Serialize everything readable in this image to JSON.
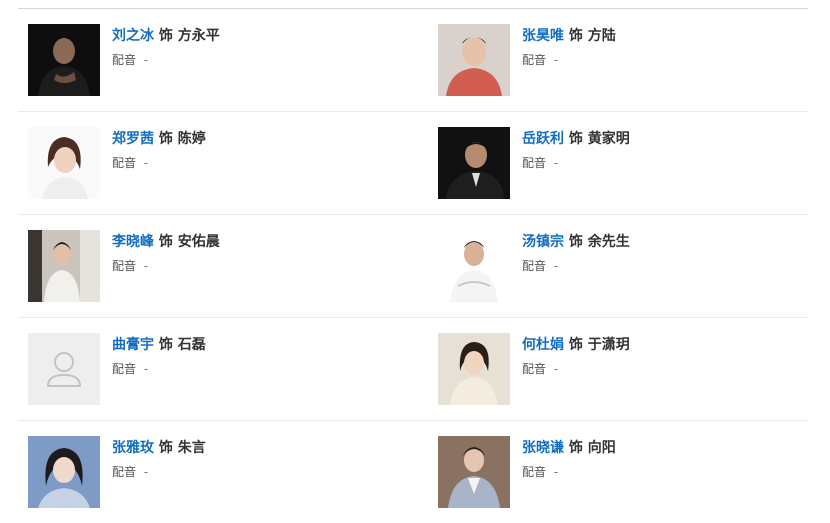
{
  "cast_list": {
    "as_word": "饰",
    "voice_label": "配音",
    "voice_empty": "-",
    "rows": [
      [
        {
          "actor": "刘之冰",
          "role": "方永平",
          "avatar": "portrait-dark-suit"
        },
        {
          "actor": "张昊唯",
          "role": "方陆",
          "avatar": "portrait-red-sweater"
        }
      ],
      [
        {
          "actor": "郑罗茜",
          "role": "陈婷",
          "avatar": "portrait-white-bg"
        },
        {
          "actor": "岳跃利",
          "role": "黄家明",
          "avatar": "portrait-dark-suit"
        }
      ],
      [
        {
          "actor": "李晓峰",
          "role": "安佑晨",
          "avatar": "portrait-window"
        },
        {
          "actor": "汤镇宗",
          "role": "余先生",
          "avatar": "portrait-white-shirt"
        }
      ],
      [
        {
          "actor": "曲膏宇",
          "role": "石磊",
          "avatar": "placeholder-person-icon"
        },
        {
          "actor": "何杜娟",
          "role": "于潇玥",
          "avatar": "portrait-light-dress"
        }
      ],
      [
        {
          "actor": "张雅玫",
          "role": "朱言",
          "avatar": "portrait-blue-tone"
        },
        {
          "actor": "张晓谦",
          "role": "向阳",
          "avatar": "portrait-grey-suit"
        }
      ]
    ]
  }
}
